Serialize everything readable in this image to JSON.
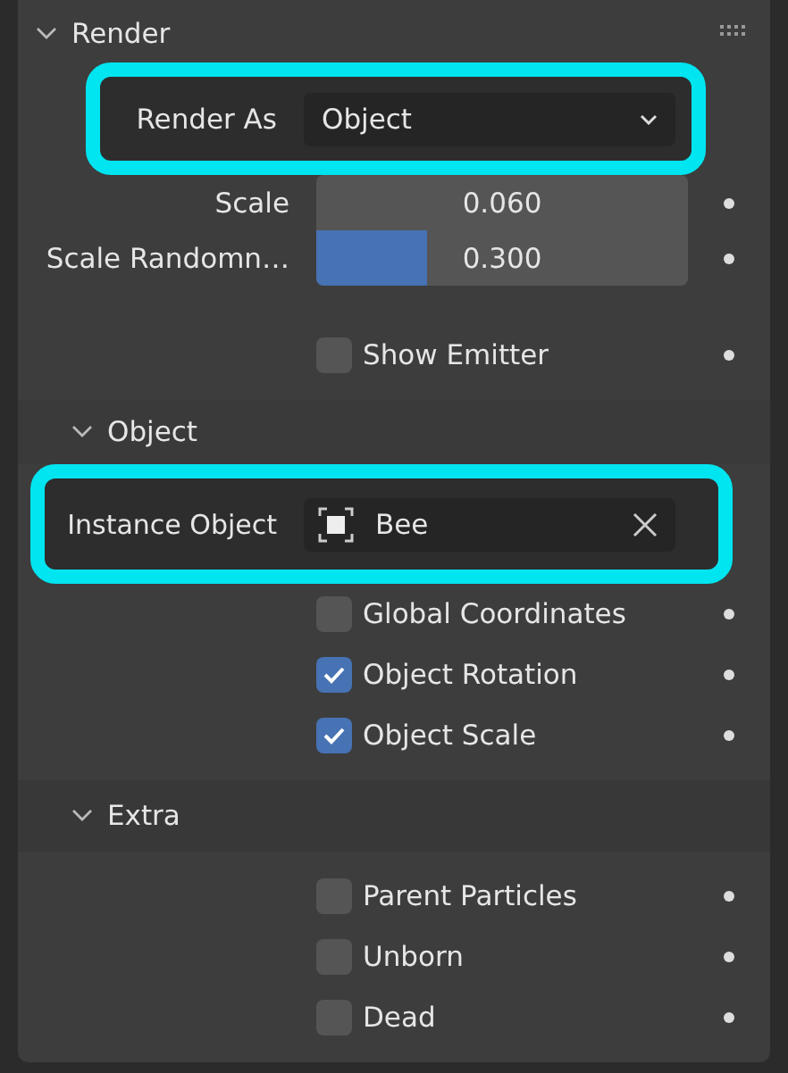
{
  "render_panel": {
    "title": "Render",
    "expanded": true,
    "render_as": {
      "label": "Render As",
      "value": "Object",
      "highlighted": true
    },
    "sliders": [
      {
        "label": "Scale",
        "value": "0.060",
        "kind": "number"
      },
      {
        "label": "Scale Randomn…",
        "value": "0.300",
        "kind": "factor",
        "level": 0.3
      }
    ],
    "show_emitter": {
      "label": "Show Emitter",
      "checked": false
    }
  },
  "object_panel": {
    "title": "Object",
    "expanded": true,
    "instance_object": {
      "label": "Instance Object",
      "value": "Bee",
      "highlighted": true
    },
    "options": [
      {
        "label": "Global Coordinates",
        "checked": false
      },
      {
        "label": "Object Rotation",
        "checked": true
      },
      {
        "label": "Object Scale",
        "checked": true
      }
    ]
  },
  "extra_panel": {
    "title": "Extra",
    "expanded": true,
    "options": [
      {
        "label": "Parent Particles",
        "checked": false
      },
      {
        "label": "Unborn",
        "checked": false
      },
      {
        "label": "Dead",
        "checked": false
      }
    ]
  }
}
